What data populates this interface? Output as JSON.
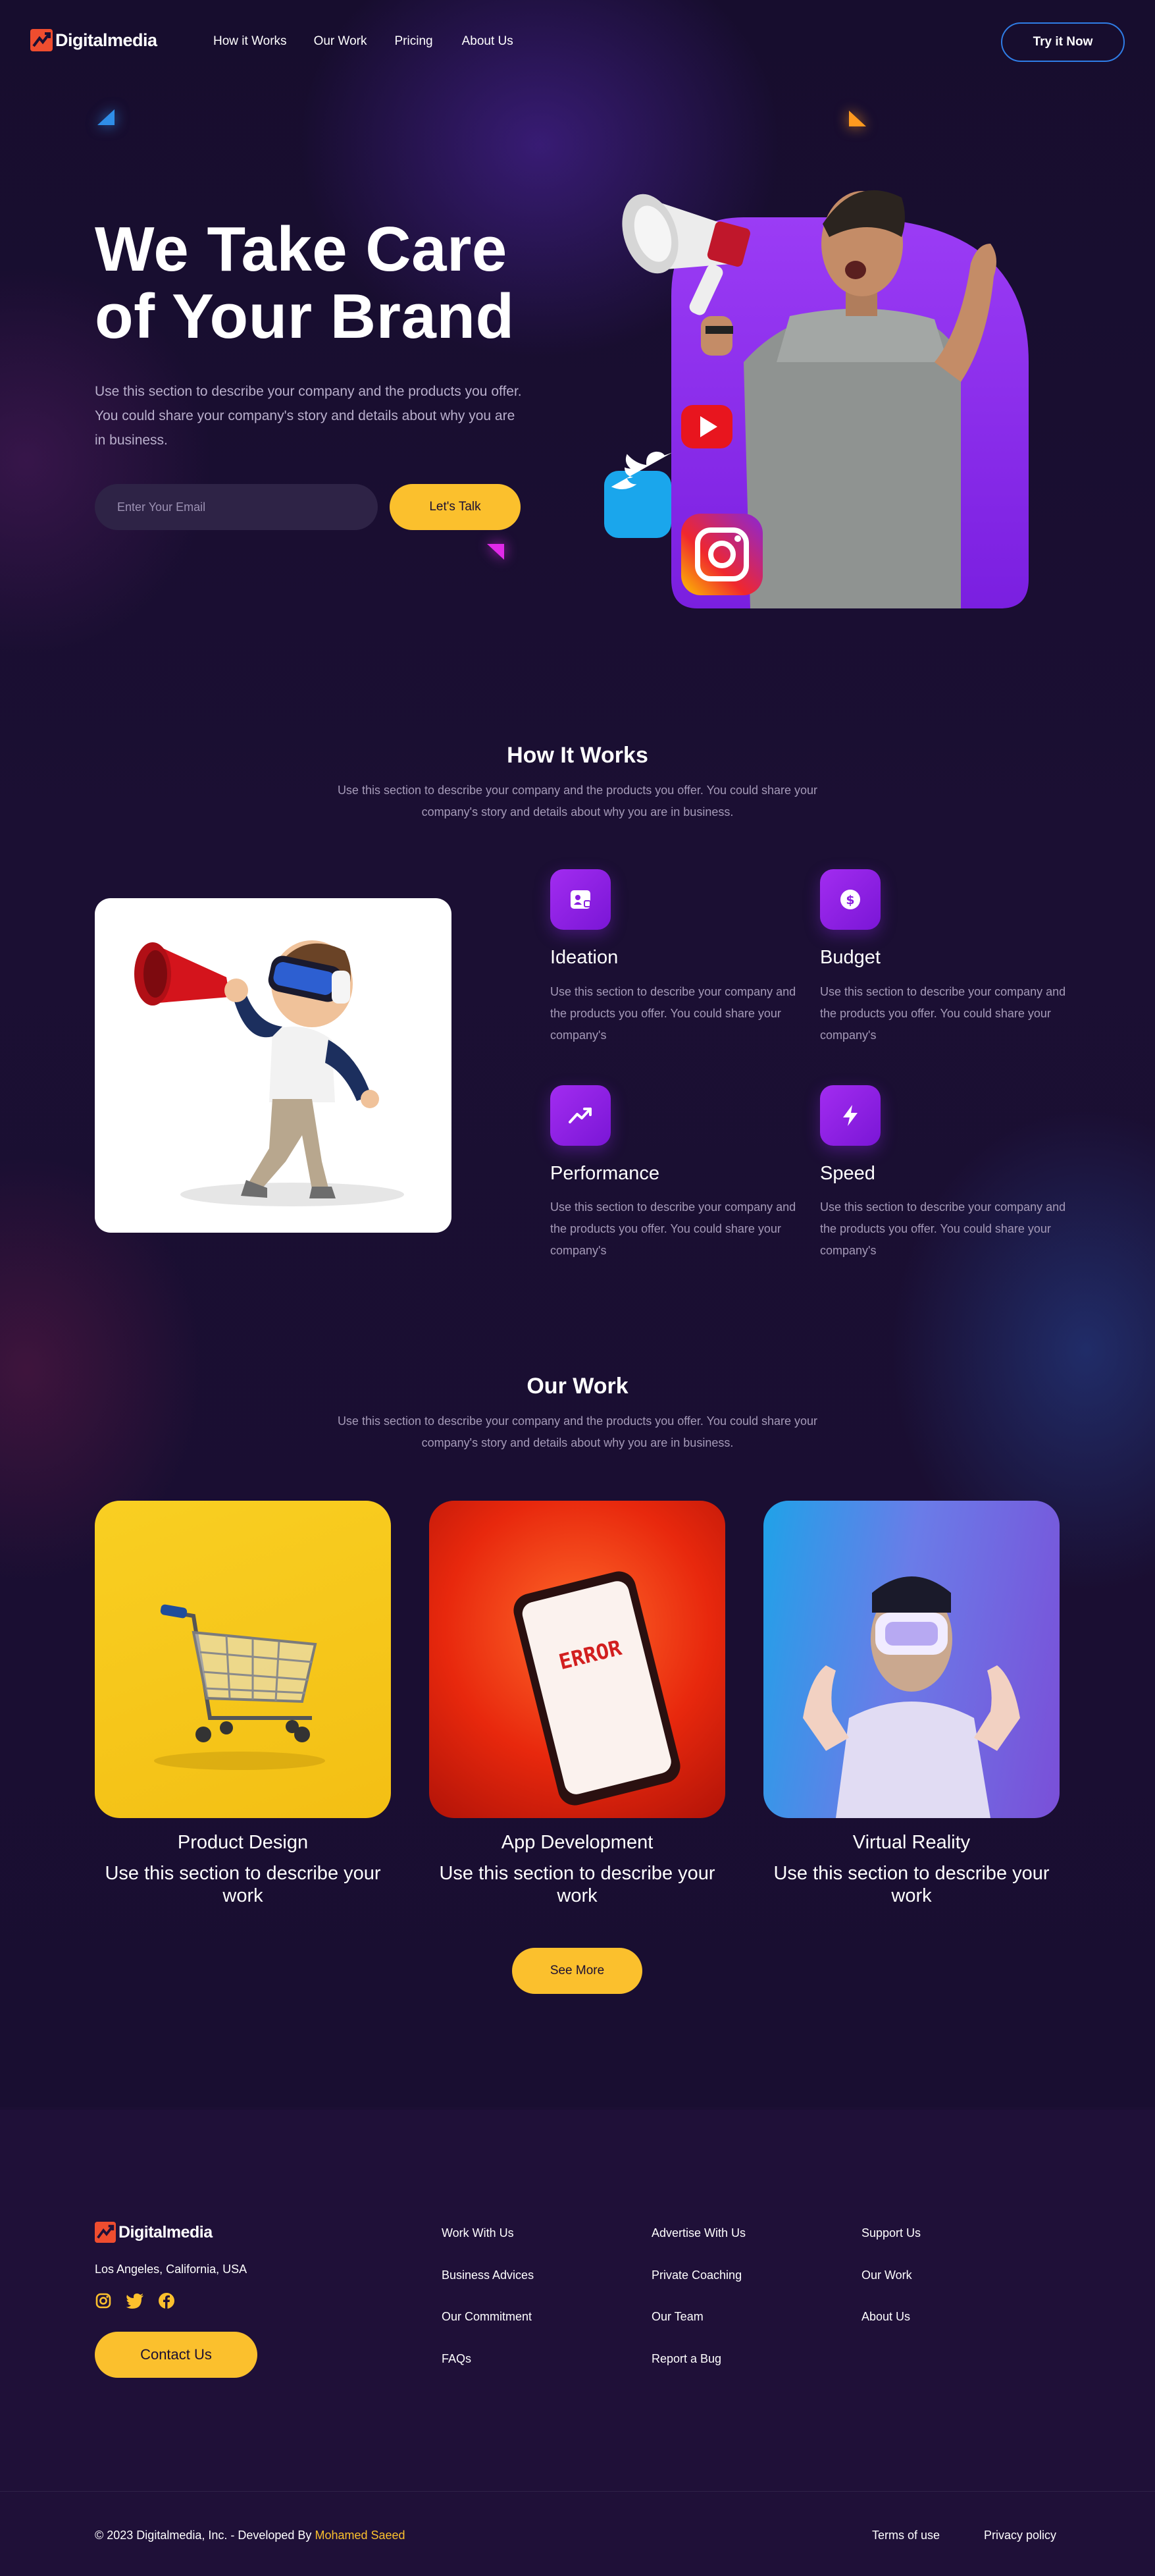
{
  "brand": {
    "name": "Digitalmedia",
    "logo_color": "#ef4d2f"
  },
  "nav": {
    "items": [
      "How it Works",
      "Our Work",
      "Pricing",
      "About Us"
    ],
    "cta": "Try it Now"
  },
  "hero": {
    "title_line1": "We Take Care",
    "title_line2": "of Your Brand",
    "description": "Use this section to describe your company and the products you offer. You could share your company's story and details about why you are in business.",
    "email_placeholder": "Enter Your Email",
    "cta": "Let's Talk"
  },
  "how_it_works": {
    "title": "How It Works",
    "description": "Use this section to describe your company and the products you offer. You could share your company's story and details about why you are in business.",
    "features": [
      {
        "icon": "id-card-icon",
        "title": "Ideation",
        "desc": "Use this section to describe your company and the products you offer. You could share your company's"
      },
      {
        "icon": "dollar-icon",
        "title": "Budget",
        "desc": "Use this section to describe your company and the products you offer. You could share your company's"
      },
      {
        "icon": "trend-up-icon",
        "title": "Performance",
        "desc": "Use this section to describe your company and the products you offer. You could share your company's"
      },
      {
        "icon": "lightning-icon",
        "title": "Speed",
        "desc": "Use this section to describe your company and the products you offer. You could share your company's"
      }
    ]
  },
  "our_work": {
    "title": "Our Work",
    "description": "Use this section to describe your company and the products you offer. You could share your company's story and details about why you are in business.",
    "cards": [
      {
        "title": "Product Design",
        "desc": "Use this section to describe your work"
      },
      {
        "title": "App Development",
        "desc": "Use this section to describe your work",
        "screen_text": "ERROR"
      },
      {
        "title": "Virtual Reality",
        "desc": "Use this section to describe your work"
      }
    ],
    "cta": "See More"
  },
  "footer": {
    "location": "Los Angeles, California, USA",
    "cta": "Contact Us",
    "columns": [
      [
        "Work With Us",
        "Business Advices",
        "Our Commitment",
        "FAQs"
      ],
      [
        "Advertise With Us",
        "Private Coaching",
        "Our Team",
        "Report a Bug"
      ],
      [
        "Support Us",
        "Our Work",
        "About Us"
      ]
    ],
    "copyright": "© 2023 Digitalmedia, Inc. - Developed By",
    "developer": "Mohamed Saeed",
    "terms": "Terms of use",
    "privacy": "Privacy policy"
  },
  "colors": {
    "accent_yellow": "#fbc02d",
    "accent_purple": "#8a1ee0",
    "background": "#1b0f33"
  }
}
